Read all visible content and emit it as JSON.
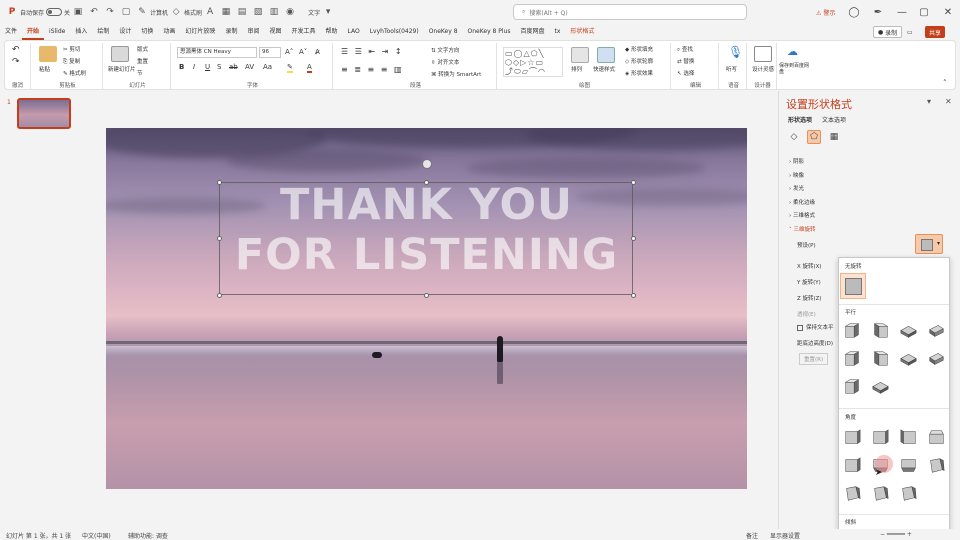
{
  "titlebar": {
    "autosave": "自动保存",
    "autosave_state": "关",
    "toolbar_item_a": "计算机",
    "toolbar_item_b": "格式刷",
    "toolbar_item_c": "文字",
    "search_placeholder": "搜索(Alt + Q)",
    "warning": "警示",
    "share": "共享"
  },
  "menu_tabs": [
    "文件",
    "开始",
    "iSlide",
    "插入",
    "绘制",
    "设计",
    "切换",
    "动画",
    "幻灯片放映",
    "录制",
    "审阅",
    "视图",
    "开发工具",
    "帮助",
    "LAO",
    "LvyhTools(0429)",
    "OneKey 8",
    "OneKey 8 Plus",
    "百度网盘",
    "tx",
    "形状格式"
  ],
  "menu_right": {
    "record": "录制",
    "share": "共享"
  },
  "ribbon": {
    "undo_group": "撤消",
    "clipboard": {
      "label": "剪贴板",
      "paste": "粘贴",
      "cut": "剪切",
      "copy": "复制",
      "format_painter": "格式刷"
    },
    "slides": {
      "label": "幻灯片",
      "new": "新建幻灯片",
      "layout": "版式",
      "reset": "重置",
      "section": "节"
    },
    "font": {
      "label": "字体",
      "name": "思源黑体 CN Heavy",
      "size": "96"
    },
    "paragraph": {
      "label": "段落",
      "direction": "文字方向",
      "align": "对齐文本",
      "smartart": "转换为 SmartArt"
    },
    "drawing": {
      "label": "绘图",
      "arrange": "排列",
      "quick_styles": "快速样式",
      "fill": "形状填充",
      "outline": "形状轮廓",
      "effects": "形状效果"
    },
    "editing": {
      "label": "编辑",
      "find": "查找",
      "replace": "替换",
      "select": "选择"
    },
    "voice": {
      "label": "语音",
      "dictate": "听写"
    },
    "designer": {
      "label": "设计器",
      "ideas": "设计灵感"
    },
    "save": {
      "label": "",
      "cloud": "保存到百度网盘"
    }
  },
  "slide_panel": {
    "number": "1"
  },
  "slide": {
    "line1": "THANK YOU",
    "line2": "FOR LISTENING"
  },
  "pane": {
    "title": "设置形状格式",
    "subtab_shape": "形状选项",
    "subtab_text": "文本选项",
    "sections": [
      "阴影",
      "映像",
      "发光",
      "柔化边缘",
      "三维格式",
      "三维旋转"
    ],
    "preset_label": "预设(P)",
    "x_rotation": "X 旋转(X)",
    "y_rotation": "Y 旋转(Y)",
    "z_rotation": "Z 旋转(Z)",
    "perspective": "透视(E)",
    "keep_text_flat": "保持文本平",
    "distance": "距底边高度(D)",
    "reset": "重置(R)"
  },
  "gallery": {
    "no_rotation": "无旋转",
    "parallel": "平行",
    "perspective": "角度",
    "oblique": "倾斜"
  },
  "statusbar": {
    "slide_info": "幻灯片 第 1 张，共 1 张",
    "language": "中文(中国)",
    "accessibility": "辅助功能: 调查",
    "notes": "备注",
    "display": "显示器设置"
  },
  "colors": {
    "accent": "#c43e1c",
    "selected_preset": "#f8c9a8"
  }
}
